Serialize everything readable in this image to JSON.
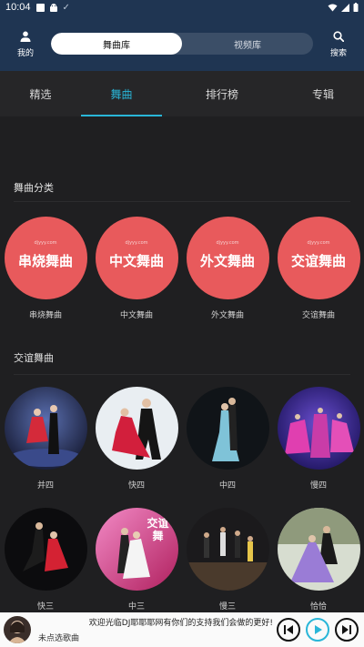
{
  "status_bar": {
    "time": "10:04"
  },
  "header": {
    "me_label": "我的",
    "search_label": "搜索",
    "segments": [
      {
        "label": "舞曲库",
        "active": true
      },
      {
        "label": "视频库",
        "active": false
      }
    ]
  },
  "tabs": [
    {
      "label": "精选",
      "active": false
    },
    {
      "label": "舞曲",
      "active": true
    },
    {
      "label": "排行榜",
      "active": false
    },
    {
      "label": "专辑",
      "active": false
    }
  ],
  "categories": {
    "title": "舞曲分类",
    "items": [
      {
        "badge": "串烧舞曲",
        "label": "串烧舞曲",
        "mini": "djyyy.com"
      },
      {
        "badge": "中文舞曲",
        "label": "中文舞曲",
        "mini": "djyyy.com"
      },
      {
        "badge": "外文舞曲",
        "label": "外文舞曲",
        "mini": "djyyy.com"
      },
      {
        "badge": "交谊舞曲",
        "label": "交谊舞曲",
        "mini": "djyyy.com"
      }
    ]
  },
  "ballroom": {
    "title": "交谊舞曲",
    "row1": [
      {
        "label": "并四",
        "theme": "red-stage"
      },
      {
        "label": "快四",
        "theme": "red-dress"
      },
      {
        "label": "中四",
        "theme": "dark-blue"
      },
      {
        "label": "慢四",
        "theme": "purple-couples"
      }
    ],
    "row2": [
      {
        "label": "快三",
        "theme": "dark-red"
      },
      {
        "label": "中三",
        "theme": "pink-poster",
        "overlay": "交谊舞"
      },
      {
        "label": "慢三",
        "theme": "dark-crowd"
      },
      {
        "label": "恰恰",
        "theme": "purple-gown"
      }
    ]
  },
  "player": {
    "marquee": "欢迎光临DJ耶耶耶网有你们的支持我们会做的更好!",
    "song": "未点选歌曲"
  },
  "colors": {
    "accent": "#29b6d8",
    "header": "#1f3552",
    "category": "#e85a5c"
  }
}
